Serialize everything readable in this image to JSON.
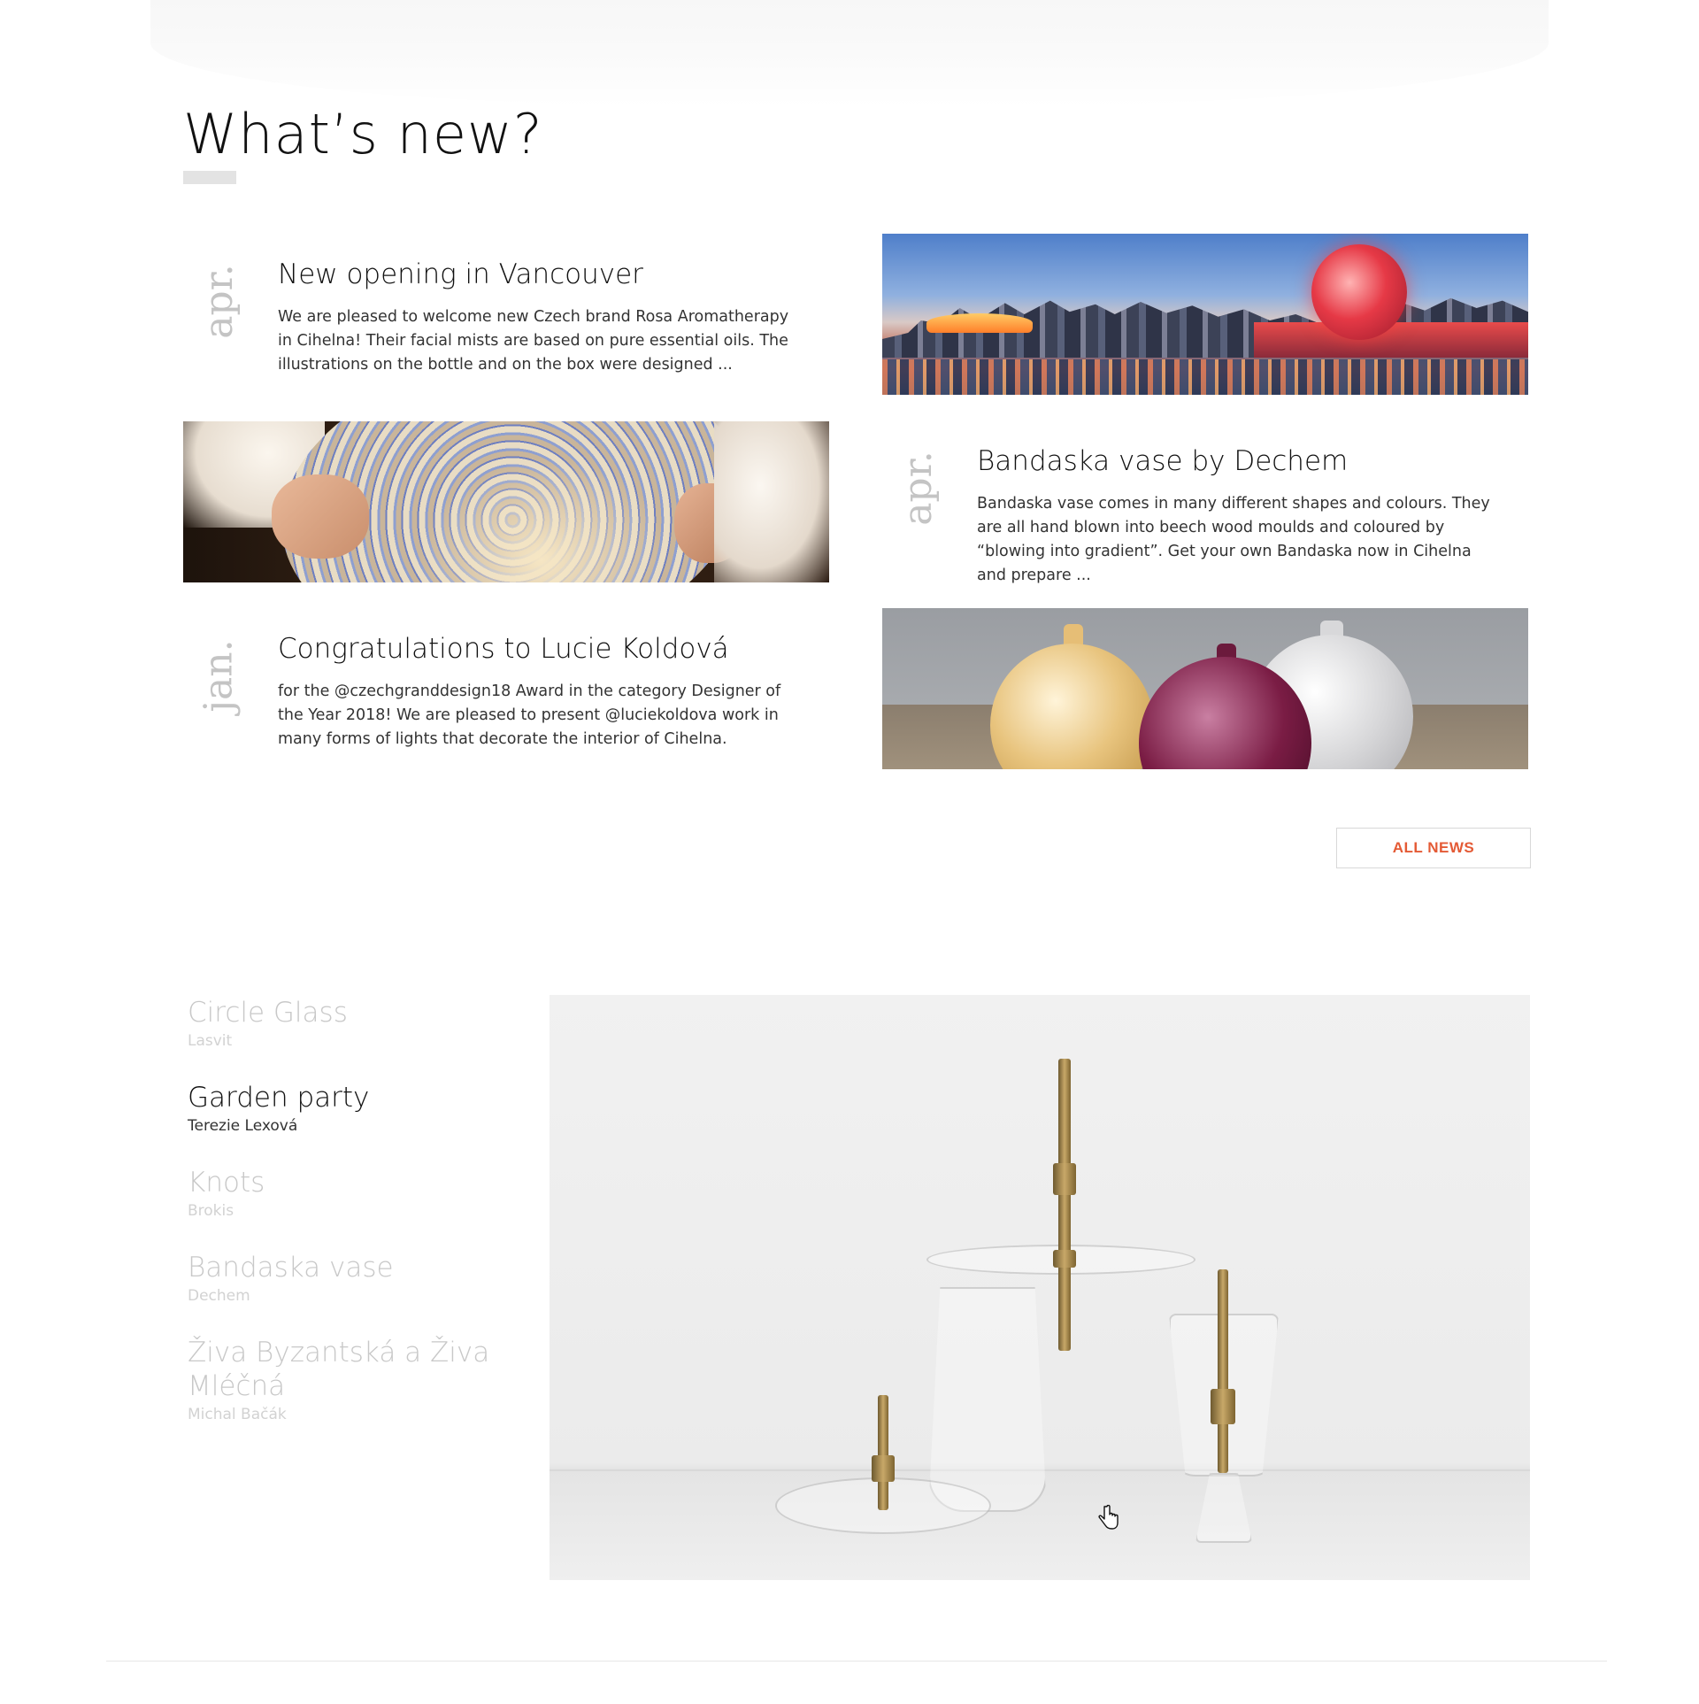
{
  "section": {
    "title": "What’s new?"
  },
  "news": [
    {
      "month": "apr.",
      "title": "New opening in Vancouver",
      "excerpt": "We are pleased to welcome new Czech brand Rosa Aromatherapy in Cihelna! Their facial mists are based on pure essential oils. The illustrations on the bottle and on the box were designed ..."
    },
    {
      "month": "apr.",
      "title": "Bandaska vase by Dechem",
      "excerpt": "Bandaska vase comes in many different shapes and colours. They are all hand blown into beech wood moulds and coloured by “blowing into gradient”. Get your own Bandaska now in Cihelna and prepare ..."
    },
    {
      "month": "jan.",
      "title": "Congratulations to Lucie Koldová",
      "excerpt": "for the @czechgranddesign18 Award in the category Designer of the Year 2018! We are pleased to present @luciekoldova work in many forms of lights that decorate the interior of Cihelna."
    }
  ],
  "all_news_label": "ALL NEWS",
  "products": [
    {
      "name": "Circle Glass",
      "maker": "Lasvit",
      "active": false
    },
    {
      "name": "Garden party",
      "maker": "Terezie Lexová",
      "active": true
    },
    {
      "name": "Knots",
      "maker": "Brokis",
      "active": false
    },
    {
      "name": "Bandaska vase",
      "maker": "Dechem",
      "active": false
    },
    {
      "name": "Živa Byzantská a Živa Mléčná",
      "maker": "Michal Bačák",
      "active": false
    }
  ],
  "colors": {
    "accent": "#e45a35",
    "text": "#111111",
    "muted": "#c8c8c8"
  },
  "icons": {
    "cursor": "hand-pointer-icon"
  }
}
